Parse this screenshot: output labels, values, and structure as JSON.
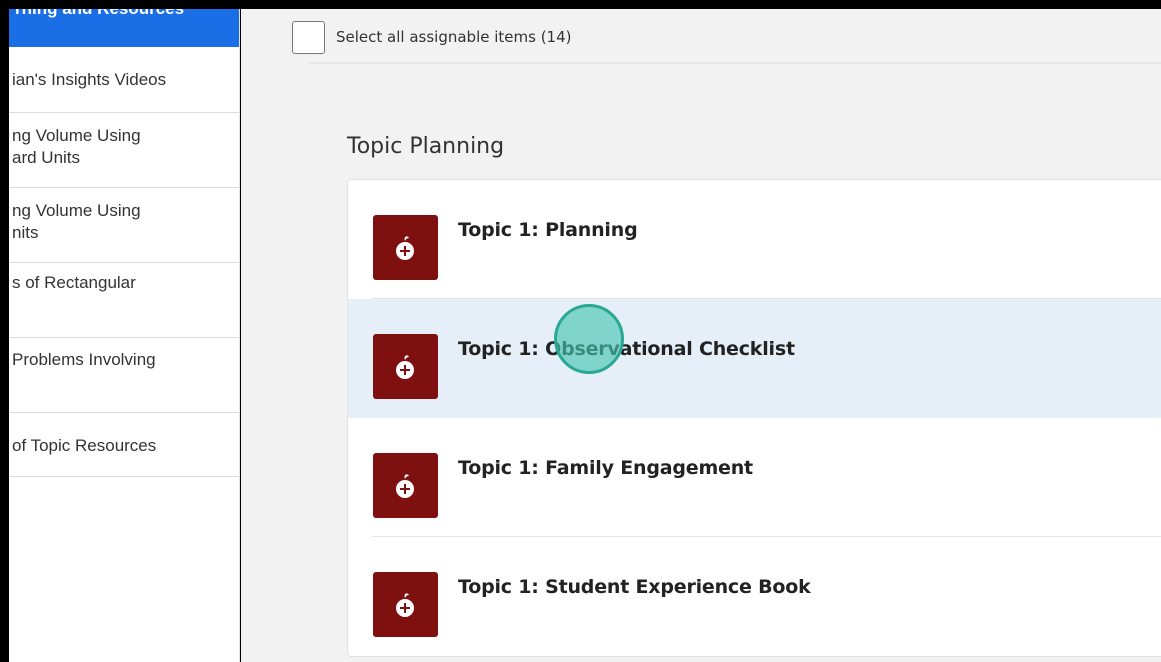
{
  "sidebar": {
    "active_label": "rning and Resources",
    "items": [
      {
        "lines": [
          "ian's Insights Videos"
        ]
      },
      {
        "lines": [
          "ng Volume Using",
          "ard Units"
        ]
      },
      {
        "lines": [
          "ng Volume Using",
          "nits"
        ]
      },
      {
        "lines": [
          "s of Rectangular"
        ]
      },
      {
        "lines": [
          "Problems Involving"
        ]
      },
      {
        "lines": [
          "of Topic Resources"
        ]
      }
    ]
  },
  "main": {
    "select_all_label": "Select all assignable items (14)",
    "section_title": "Topic Planning",
    "items": [
      {
        "title": "Topic 1: Planning",
        "icon": "apple-icon"
      },
      {
        "title": "Topic 1: Observational Checklist",
        "icon": "apple-icon"
      },
      {
        "title": "Topic 1: Family Engagement",
        "icon": "apple-icon"
      },
      {
        "title": "Topic 1: Student Experience Book",
        "icon": "apple-icon"
      }
    ]
  },
  "colors": {
    "sidebar_active_bg": "#1b6fe6",
    "icon_bg": "#7e1010",
    "highlight_row_bg": "#e6eff8",
    "click_indicator": "#48c4b2"
  }
}
